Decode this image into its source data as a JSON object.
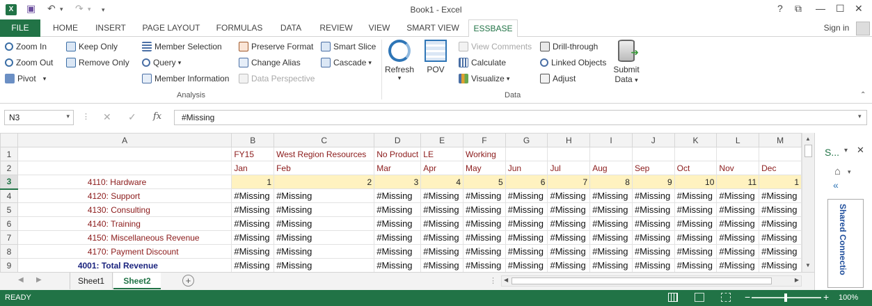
{
  "window": {
    "title": "Book1 - Excel",
    "signin": "Sign in",
    "help": "?",
    "controls": [
      "⧉",
      "—",
      "☐",
      "✕"
    ]
  },
  "ribbon_tabs": [
    "FILE",
    "HOME",
    "INSERT",
    "PAGE LAYOUT",
    "FORMULAS",
    "DATA",
    "REVIEW",
    "VIEW",
    "SMART VIEW",
    "ESSBASE"
  ],
  "ribbon": {
    "zoom_in": "Zoom In",
    "zoom_out": "Zoom Out",
    "pivot": "Pivot",
    "keep_only": "Keep Only",
    "remove_only": "Remove Only",
    "member_selection": "Member Selection",
    "query": "Query",
    "member_information": "Member Information",
    "preserve_format": "Preserve Format",
    "change_alias": "Change Alias",
    "data_perspective": "Data Perspective",
    "smart_slice": "Smart Slice",
    "cascade": "Cascade",
    "analysis_group": "Analysis",
    "refresh": "Refresh",
    "pov": "POV",
    "view_comments": "View Comments",
    "calculate": "Calculate",
    "visualize": "Visualize",
    "drill_through": "Drill-through",
    "linked_objects": "Linked Objects",
    "adjust": "Adjust",
    "submit_data_1": "Submit",
    "submit_data_2": "Data",
    "data_group": "Data"
  },
  "formula": {
    "namebox": "N3",
    "fx": "fx",
    "value": "#Missing"
  },
  "grid": {
    "col_headers": [
      "A",
      "B",
      "C",
      "D",
      "E",
      "F",
      "G",
      "H",
      "I",
      "J",
      "K",
      "L",
      "M"
    ],
    "row_headers": [
      "1",
      "2",
      "3",
      "4",
      "5",
      "6",
      "7",
      "8",
      "9"
    ],
    "row1": [
      "",
      "FY15",
      "West Region Resources",
      "No Product",
      "LE",
      "Working",
      "",
      "",
      "",
      "",
      "",
      "",
      ""
    ],
    "row2": [
      "",
      "Jan",
      "Feb",
      "Mar",
      "Apr",
      "May",
      "Jun",
      "Jul",
      "Aug",
      "Sep",
      "Oct",
      "Nov",
      "Dec"
    ],
    "row3": [
      "4110: Hardware",
      "1",
      "2",
      "3",
      "4",
      "5",
      "6",
      "7",
      "8",
      "9",
      "10",
      "11",
      "1"
    ],
    "members": [
      "4120: Support",
      "4130: Consulting",
      "4140: Training",
      "4150: Miscellaneous Revenue",
      "4170: Payment Discount",
      "4001: Total Revenue"
    ],
    "missing": "#Missing"
  },
  "sheets": [
    "Sheet1",
    "Sheet2"
  ],
  "side_panel": {
    "title": "S...",
    "shared": "Shared Connectio"
  },
  "status": {
    "ready": "READY",
    "zoom": "100%"
  }
}
